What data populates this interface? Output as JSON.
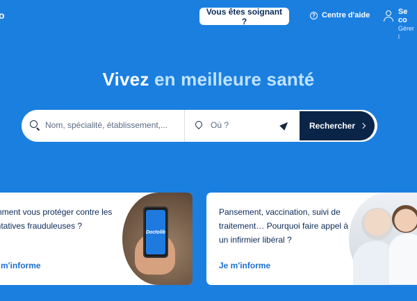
{
  "header": {
    "logo_fragment": "o",
    "pro_button": "Vous êtes soignant ?",
    "help_link": "Centre d'aide",
    "account_main": "Se co",
    "account_sub": "Gérer l"
  },
  "hero": {
    "headline_start": "Vivez ",
    "headline_accent": "en meilleure santé"
  },
  "search": {
    "query_placeholder": "Nom, spécialité, établissement,...",
    "location_placeholder": "Où ?",
    "submit_label": "Rechercher"
  },
  "cards": [
    {
      "text": "omment vous protéger contre les entatives frauduleuses ?",
      "cta": "e m'informe",
      "phone_brand": "Doctolib"
    },
    {
      "text": "Pansement, vaccination, suivi de traitement… Pourquoi faire appel à un infirmier libéral ?",
      "cta": "Je m'informe"
    }
  ],
  "colors": {
    "background": "#1b7fe0",
    "accent_text": "#bfe3ff",
    "button_dark": "#0b2548",
    "link": "#1b6fcf"
  },
  "icons": [
    "help-circle-icon",
    "user-icon",
    "search-icon",
    "location-pin-icon",
    "locate-arrow-icon",
    "chevron-right-icon"
  ]
}
